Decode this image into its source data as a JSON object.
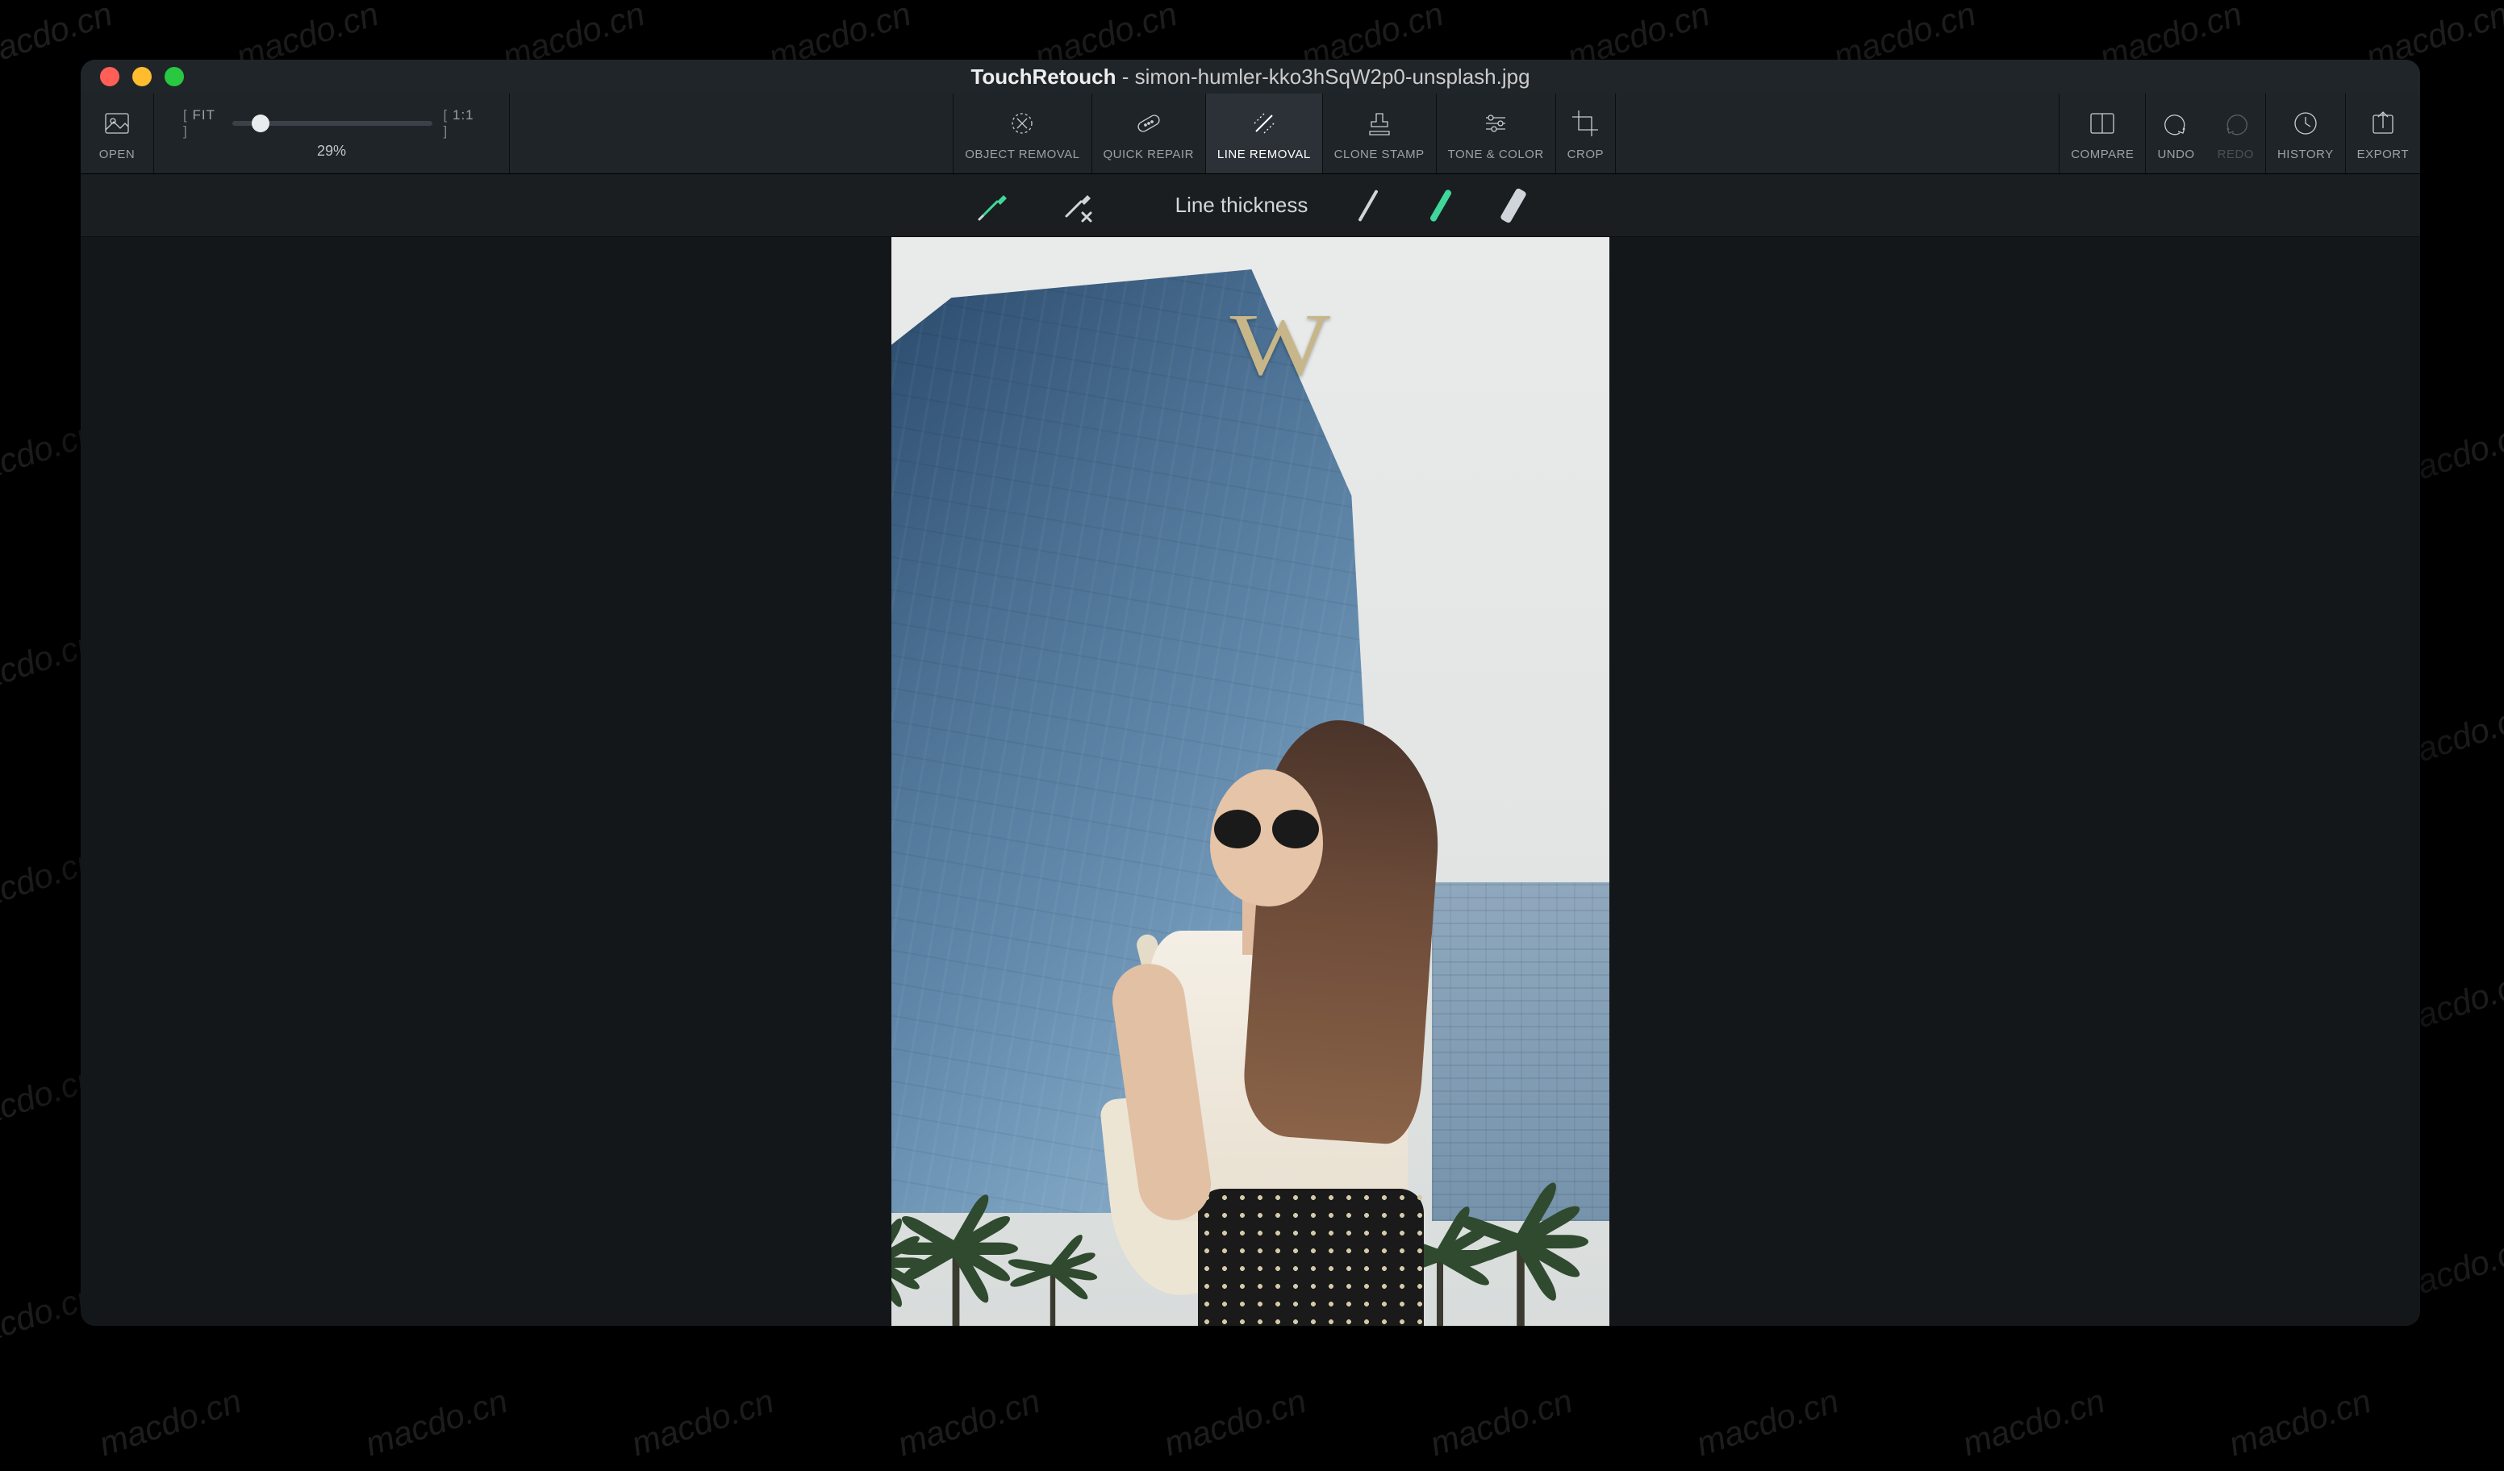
{
  "watermark_text": "macdo.cn",
  "window": {
    "app_name": "TouchRetouch",
    "file_name": "simon-humler-kko3hSqW2p0-unsplash.jpg"
  },
  "toolbar": {
    "open": "OPEN",
    "zoom": {
      "fit": "FIT",
      "one_to_one": "1:1",
      "percent": "29%"
    },
    "tools": {
      "object_removal": "OBJECT REMOVAL",
      "quick_repair": "QUICK REPAIR",
      "line_removal": "LINE REMOVAL",
      "clone_stamp": "CLONE STAMP",
      "tone_color": "TONE & COLOR",
      "crop": "CROP"
    },
    "right": {
      "compare": "COMPARE",
      "undo": "UNDO",
      "redo": "REDO",
      "history": "HISTORY",
      "export": "EXPORT"
    }
  },
  "subtoolbar": {
    "line_thickness_label": "Line thickness"
  }
}
